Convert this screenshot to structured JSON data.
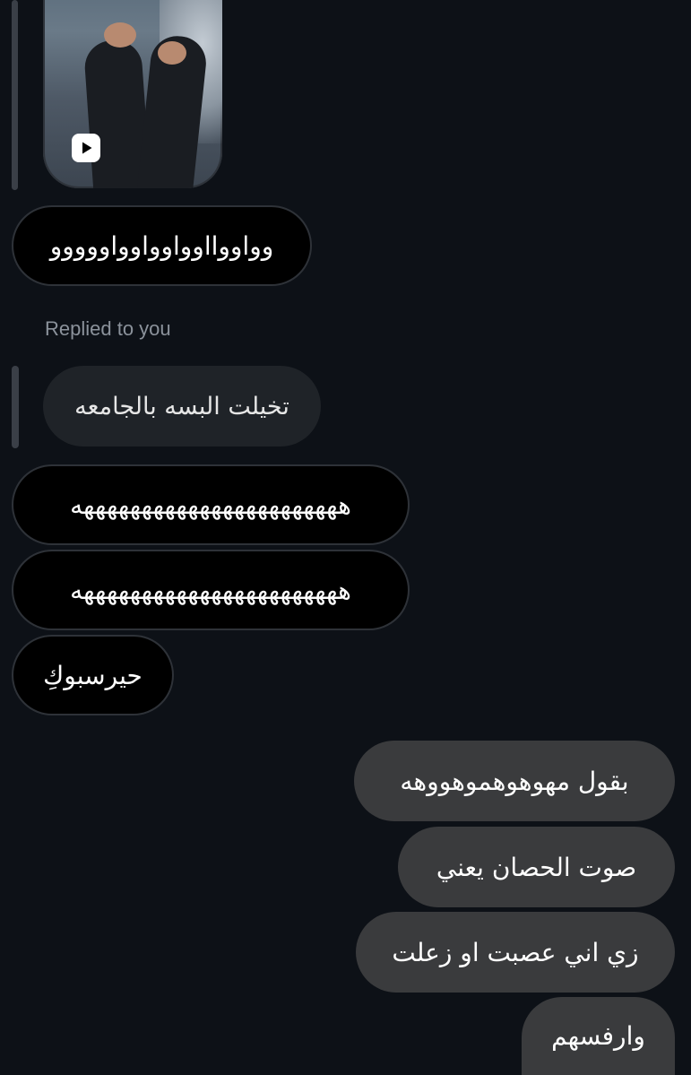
{
  "thread": {
    "reel_play_icon": "play-icon",
    "replied_label": "Replied to you",
    "quoted_message": "تخيلت البسه بالجامعه",
    "received_messages": [
      "وواووااوواوواوواووووو",
      "هههههههههههههههههههههههه",
      "هههههههههههههههههههههههه",
      "حيرسبوكِ"
    ],
    "sent_messages": [
      "بقول مهوهوهموهووهه",
      "صوت الحصان يعني",
      "زي اني عصبت او زعلت",
      "وارفسهم"
    ]
  },
  "colors": {
    "background": "#0d1117",
    "received_bubble": "#000000",
    "quoted_bubble": "#1f2328",
    "sent_bubble": "#3a3b3d",
    "text": "#ffffff",
    "muted_text": "#8b929b"
  }
}
